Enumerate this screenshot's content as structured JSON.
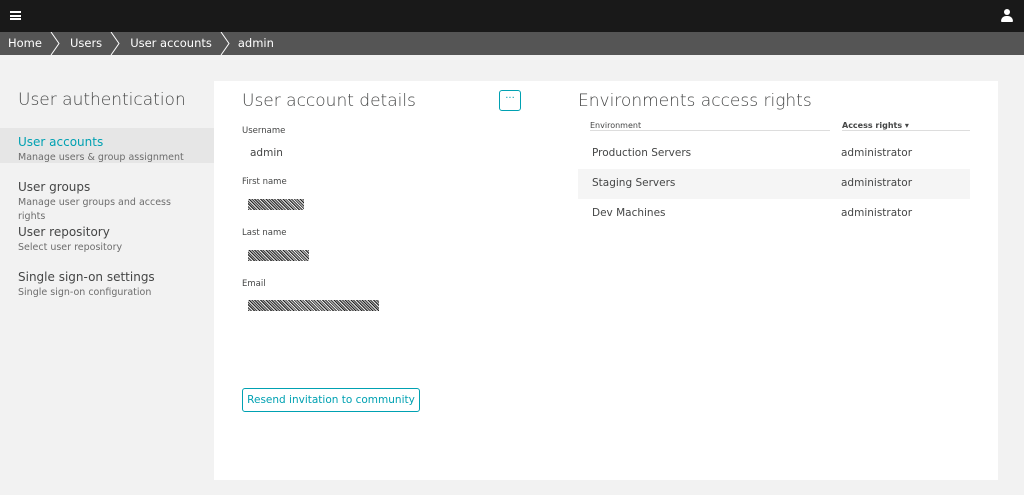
{
  "topbar": {
    "menu_icon": "hamburger-menu-icon",
    "user_icon": "user-icon"
  },
  "breadcrumb": [
    "Home",
    "Users",
    "User accounts",
    "admin"
  ],
  "sidebar": {
    "title": "User authentication",
    "items": [
      {
        "label": "User accounts",
        "desc": "Manage users & group assignment",
        "active": true
      },
      {
        "label": "User groups",
        "desc": "Manage user groups and access rights",
        "active": false
      },
      {
        "label": "User repository",
        "desc": "Select user repository",
        "active": false
      },
      {
        "label": "Single sign-on settings",
        "desc": "Single sign-on configuration",
        "active": false
      }
    ]
  },
  "details": {
    "title": "User account details",
    "more_label": "···",
    "username_label": "Username",
    "username_value": "admin",
    "firstname_label": "First name",
    "lastname_label": "Last name",
    "email_label": "Email",
    "resend_label": "Resend invitation to community"
  },
  "environments": {
    "title": "Environments access rights",
    "col_env": "Environment",
    "col_rights": "Access rights ▾",
    "rows": [
      {
        "env": "Production Servers",
        "rights": "administrator"
      },
      {
        "env": "Staging Servers",
        "rights": "administrator"
      },
      {
        "env": "Dev Machines",
        "rights": "administrator"
      }
    ]
  },
  "colors": {
    "accent": "#00a1b2",
    "topbar": "#191919",
    "breadcrumb": "#555555"
  }
}
